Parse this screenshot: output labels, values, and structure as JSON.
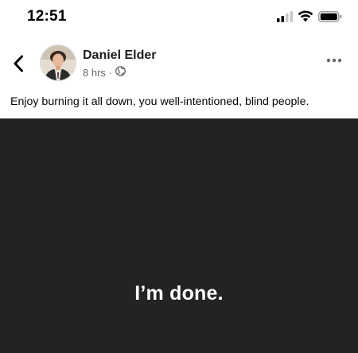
{
  "status_bar": {
    "time": "12:51",
    "icons": [
      "cellular-signal-icon",
      "wifi-icon",
      "battery-icon"
    ]
  },
  "post": {
    "author_name": "Daniel Elder",
    "time_ago": "8 hrs",
    "separator": "·",
    "audience_icon": "globe-icon",
    "caption": "Enjoy burning it all down, you well-intentioned, blind people.",
    "image_text": "I’m done."
  },
  "colors": {
    "image_background": "#232323",
    "meta_text": "#65676b",
    "primary_text": "#1c1e21"
  }
}
